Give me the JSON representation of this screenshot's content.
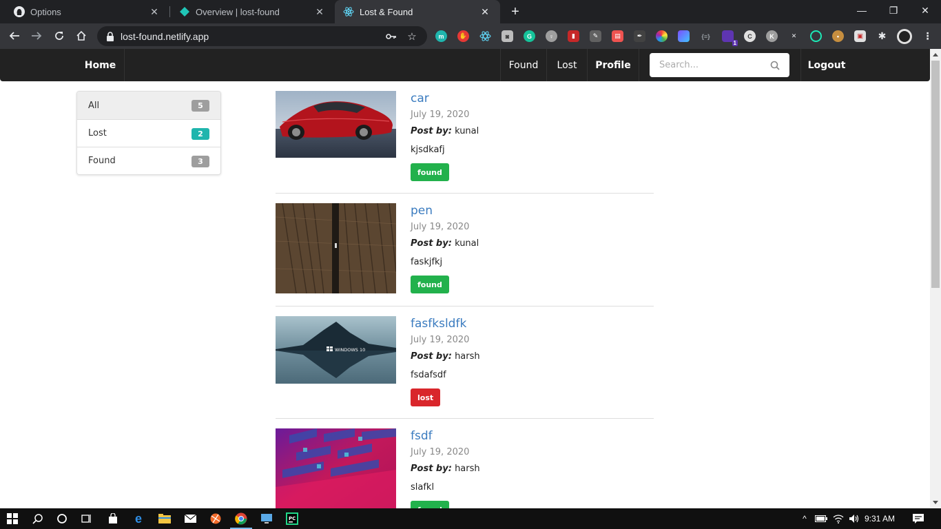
{
  "browser": {
    "tabs": [
      {
        "title": "Options",
        "icon": "github-icon"
      },
      {
        "title": "Overview | lost-found",
        "icon": "netlify-icon"
      },
      {
        "title": "Lost & Found",
        "icon": "react-icon",
        "active": true
      }
    ],
    "url": "lost-found.netlify.app",
    "extension_badge": "1"
  },
  "navbar": {
    "home": "Home",
    "found": "Found",
    "lost": "Lost",
    "profile": "Profile",
    "search_placeholder": "Search...",
    "logout": "Logout"
  },
  "filters": [
    {
      "label": "All",
      "count": "5",
      "color": "#9e9e9e"
    },
    {
      "label": "Lost",
      "count": "2",
      "color": "#1fb5ad"
    },
    {
      "label": "Found",
      "count": "3",
      "color": "#9e9e9e"
    }
  ],
  "posts": [
    {
      "title": "car",
      "date": "July 19, 2020",
      "by_label": "Post by:",
      "author": "kunal",
      "description": "kjsdkafj",
      "status": "found"
    },
    {
      "title": "pen",
      "date": "July 19, 2020",
      "by_label": "Post by:",
      "author": "kunal",
      "description": "faskjfkj",
      "status": "found"
    },
    {
      "title": "fasfksldfk",
      "date": "July 19, 2020",
      "by_label": "Post by:",
      "author": "harsh",
      "description": "fsdafsdf",
      "status": "lost",
      "image_text": "WINDOWS 10"
    },
    {
      "title": "fsdf",
      "date": "July 19, 2020",
      "by_label": "Post by:",
      "author": "harsh",
      "description": "slafkl",
      "status": "found"
    }
  ],
  "status_colors": {
    "found": "#22b14c",
    "lost": "#d9262b"
  },
  "taskbar": {
    "time": "9:31 AM"
  }
}
